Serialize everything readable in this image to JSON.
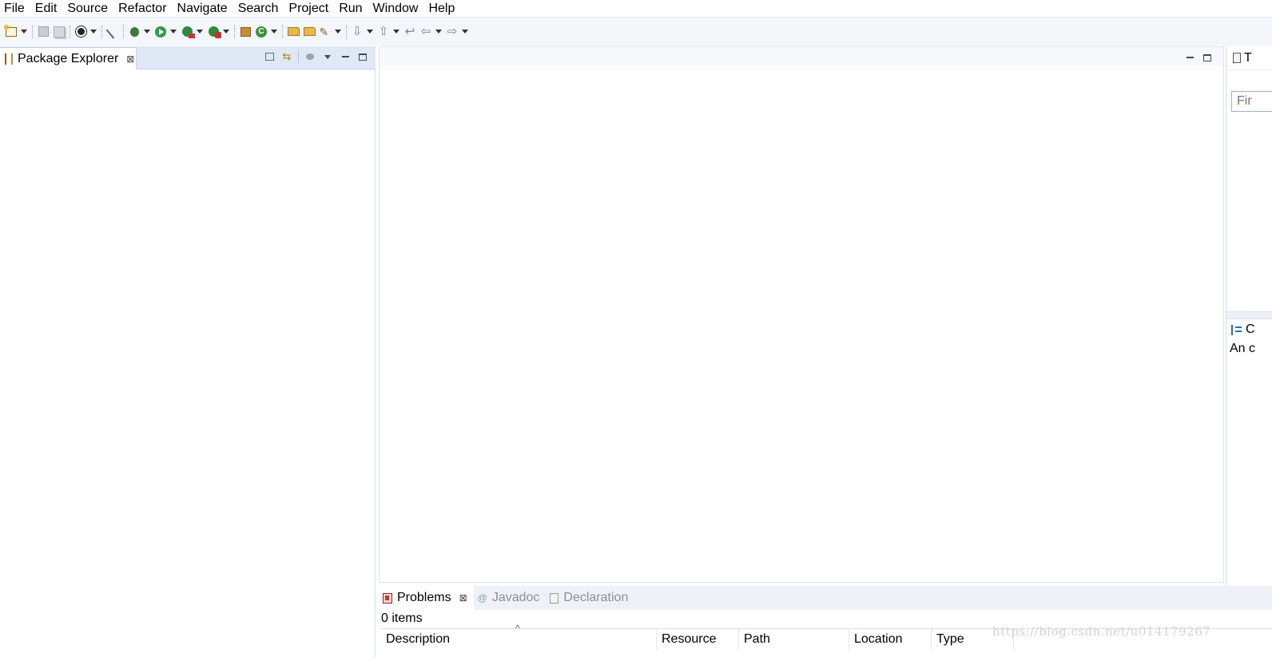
{
  "menubar": {
    "items": [
      "File",
      "Edit",
      "Source",
      "Refactor",
      "Navigate",
      "Search",
      "Project",
      "Run",
      "Window",
      "Help"
    ]
  },
  "toolbar": {
    "icons": [
      "new-wizard-icon",
      "save-icon",
      "save-all-icon",
      "profile-icon",
      "toggle-breakpoint-icon",
      "debug-icon",
      "run-icon",
      "coverage-icon",
      "external-tools-icon",
      "new-package-icon",
      "new-class-icon",
      "open-type-icon",
      "open-task-icon",
      "search-icon",
      "next-annotation-icon",
      "previous-annotation-icon",
      "last-edit-location-icon",
      "back-icon",
      "forward-icon"
    ]
  },
  "package_explorer": {
    "tab_label": "Package Explorer",
    "close_glyph": "⊠"
  },
  "task_list": {
    "tab_label": "T",
    "find_placeholder": "Fir"
  },
  "outline": {
    "tab_label": "C",
    "message": "An c"
  },
  "problems": {
    "tabs": [
      {
        "label": "Problems",
        "active": true
      },
      {
        "label": "Javadoc",
        "active": false
      },
      {
        "label": "Declaration",
        "active": false
      }
    ],
    "item_count": "0 items",
    "columns": [
      "Description",
      "Resource",
      "Path",
      "Location",
      "Type"
    ]
  },
  "watermark": "https://blog.csdn.net/u014179267"
}
